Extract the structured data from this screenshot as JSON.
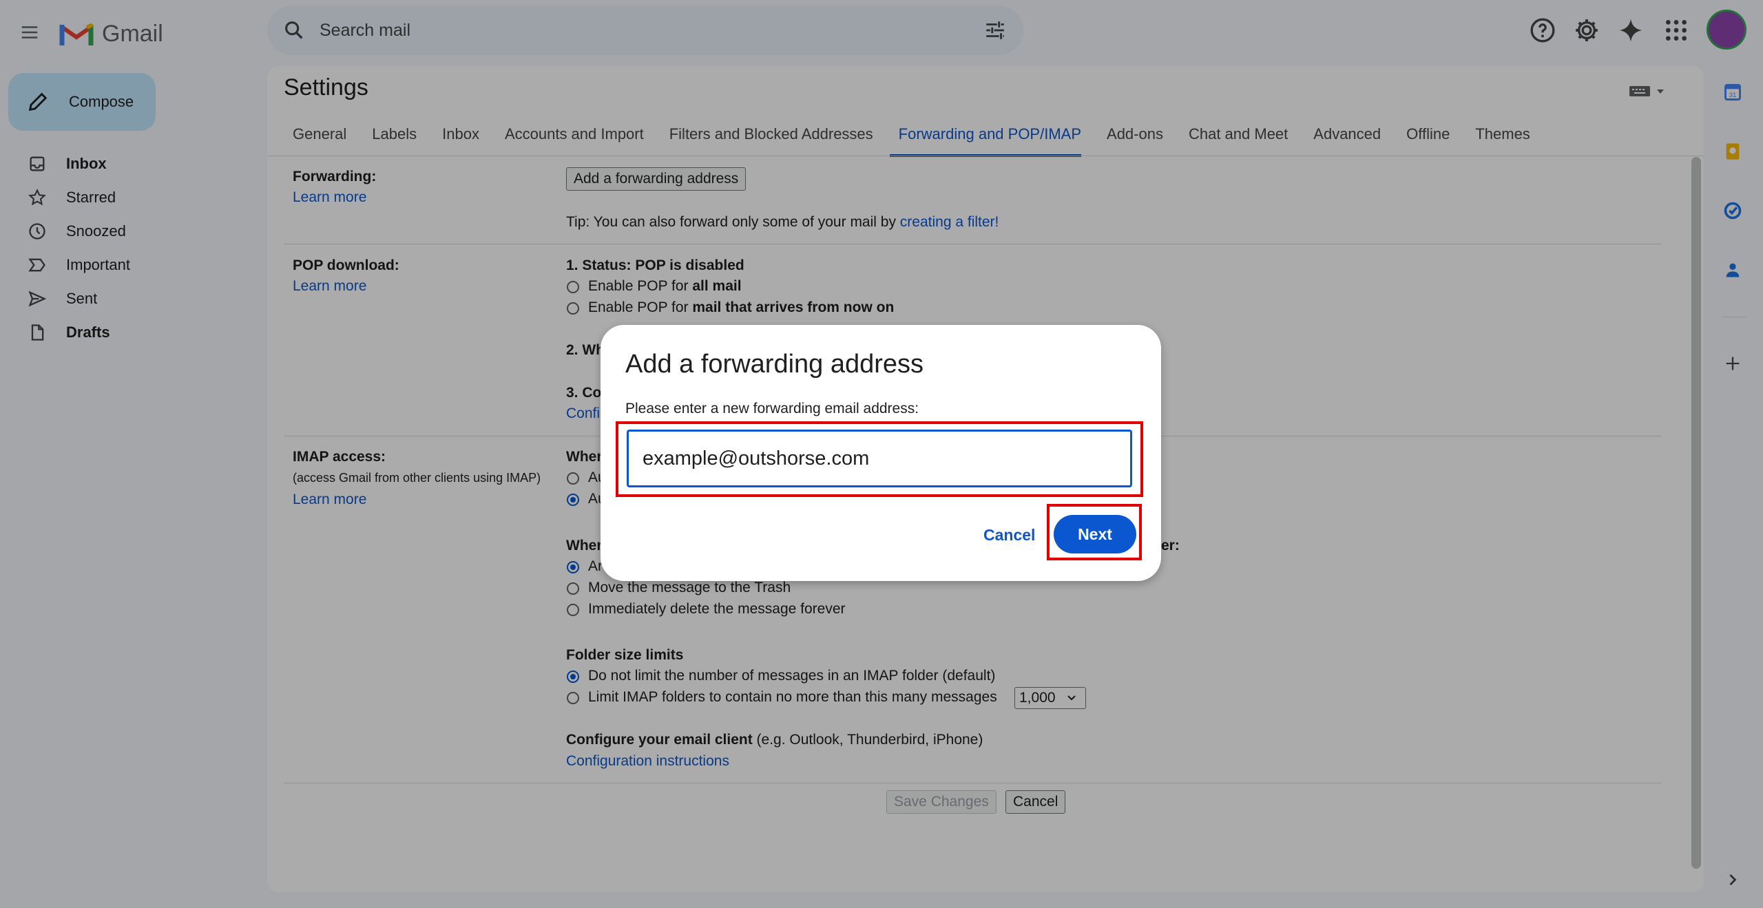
{
  "app": {
    "logo_text": "Gmail"
  },
  "search": {
    "placeholder": "Search mail"
  },
  "sidebar": {
    "compose_label": "Compose",
    "items": [
      {
        "label": "Inbox",
        "icon": "inbox-icon"
      },
      {
        "label": "Starred",
        "icon": "star-icon"
      },
      {
        "label": "Snoozed",
        "icon": "clock-icon"
      },
      {
        "label": "Important",
        "icon": "important-icon"
      },
      {
        "label": "Sent",
        "icon": "send-icon"
      },
      {
        "label": "Drafts",
        "icon": "draft-icon"
      }
    ]
  },
  "settings": {
    "title": "Settings",
    "tabs": [
      {
        "label": "General"
      },
      {
        "label": "Labels"
      },
      {
        "label": "Inbox"
      },
      {
        "label": "Accounts and Import"
      },
      {
        "label": "Filters and Blocked Addresses"
      },
      {
        "label": "Forwarding and POP/IMAP",
        "active": true
      },
      {
        "label": "Add-ons"
      },
      {
        "label": "Chat and Meet"
      },
      {
        "label": "Advanced"
      },
      {
        "label": "Offline"
      },
      {
        "label": "Themes"
      }
    ],
    "forwarding": {
      "label": "Forwarding:",
      "learn_more": "Learn more",
      "add_button": "Add a forwarding address",
      "tip_prefix": "Tip: You can also forward only some of your mail by ",
      "tip_link": "creating a filter!"
    },
    "pop": {
      "label": "POP download:",
      "learn_more": "Learn more",
      "status": "1. Status: POP is disabled",
      "option1_prefix": "Enable POP for ",
      "option1_bold": "all mail",
      "option2_prefix": "Enable POP for ",
      "option2_bold": "mail that arrives from now on",
      "step2_partial": "2. Wh",
      "step3_partial": "3. Co",
      "config_partial": "Confi"
    },
    "imap": {
      "label": "IMAP access:",
      "sublabel": "(access Gmail from other clients using IMAP)",
      "learn_more": "Learn more",
      "when_partial": "When",
      "opt_a": "Au",
      "opt_b": "Au",
      "when2_partial": "When",
      "when2_suffix": "er:",
      "opt_ar": "Ar",
      "trash_option": "Move the message to the Trash",
      "delete_option": "Immediately delete the message forever",
      "folder_heading": "Folder size limits",
      "no_limit_option": "Do not limit the number of messages in an IMAP folder (default)",
      "limit_option": "Limit IMAP folders to contain no more than this many messages",
      "limit_value": "1,000",
      "client_heading": "Configure your email client",
      "client_examples": " (e.g. Outlook, Thunderbird, iPhone)",
      "config_link": "Configuration instructions"
    },
    "footer": {
      "save": "Save Changes",
      "cancel": "Cancel"
    }
  },
  "dialog": {
    "title": "Add a forwarding address",
    "prompt": "Please enter a new forwarding email address:",
    "input_value": "example@outshorse.com",
    "cancel": "Cancel",
    "next": "Next"
  },
  "colors": {
    "accent": "#0b57d0",
    "highlight": "#e00000"
  }
}
